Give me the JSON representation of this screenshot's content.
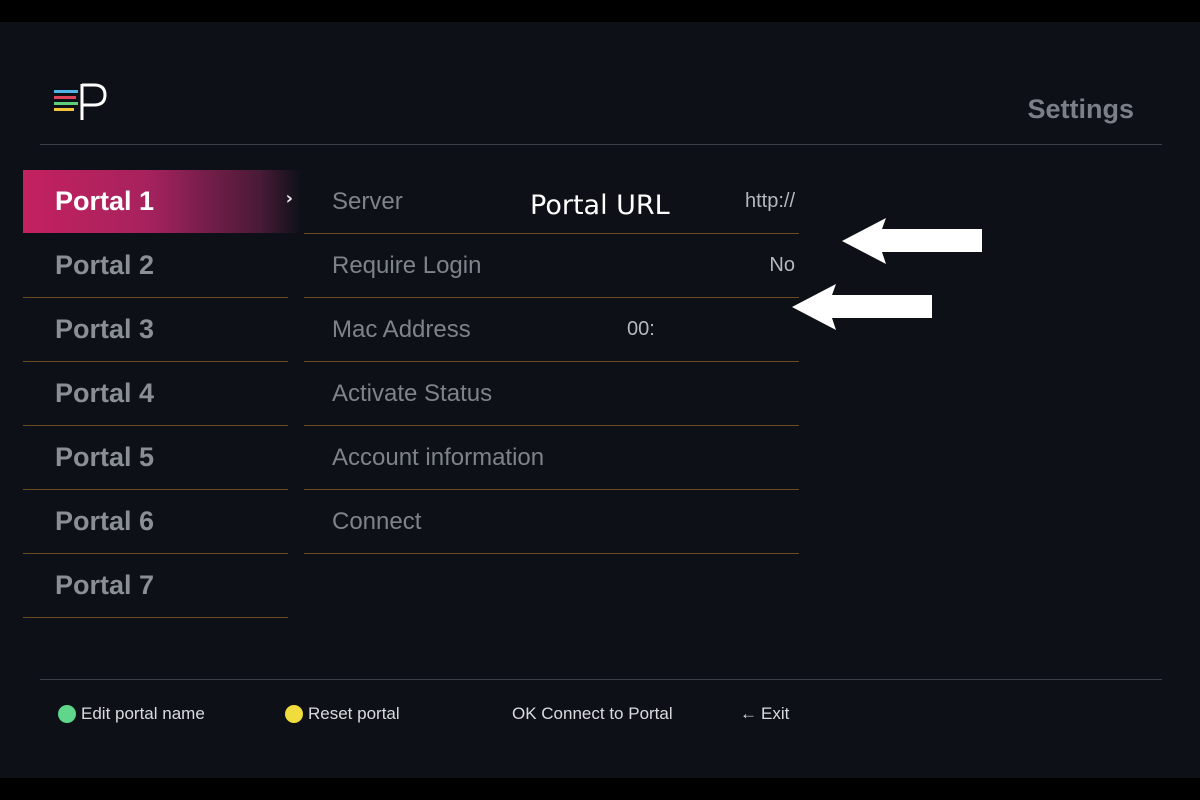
{
  "header": {
    "title": "Settings"
  },
  "sidebar": {
    "items": [
      {
        "label": "Portal 1",
        "active": true
      },
      {
        "label": "Portal 2"
      },
      {
        "label": "Portal 3"
      },
      {
        "label": "Portal 4"
      },
      {
        "label": "Portal 5"
      },
      {
        "label": "Portal 6"
      },
      {
        "label": "Portal 7"
      }
    ],
    "chevron": "›"
  },
  "settings": {
    "rows": [
      {
        "label": "Server",
        "value": "http://"
      },
      {
        "label": "Require Login",
        "value": "No"
      },
      {
        "label": "Mac Address",
        "value": "00:"
      },
      {
        "label": "Activate Status",
        "value": ""
      },
      {
        "label": "Account information",
        "value": ""
      },
      {
        "label": "Connect",
        "value": ""
      }
    ]
  },
  "overlay": {
    "annotation": "Portal URL",
    "arrows": [
      "left-arrow-icon",
      "left-arrow-icon"
    ]
  },
  "footer": {
    "green": {
      "label": "Edit portal name",
      "color": "#5fd68a"
    },
    "yellow": {
      "label": "Reset portal",
      "color": "#f0dc3c"
    },
    "ok": "OK Connect to Portal",
    "exit_arrow": "←",
    "exit": "Exit"
  },
  "colors": {
    "accent": "#c4215f",
    "background": "#0d1117",
    "divider": "#6b4a1e"
  }
}
